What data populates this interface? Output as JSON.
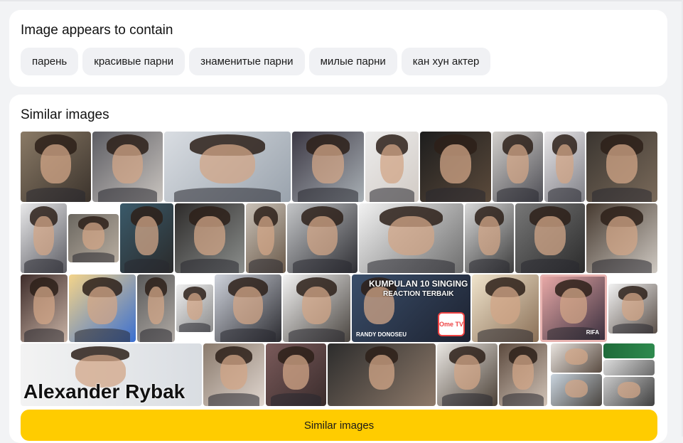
{
  "tags_section": {
    "title": "Image appears to contain",
    "chips": [
      {
        "label": "парень"
      },
      {
        "label": "красивые парни"
      },
      {
        "label": "знаменитые парни"
      },
      {
        "label": "милые парни"
      },
      {
        "label": "кан хун актер"
      }
    ]
  },
  "similar_section": {
    "title": "Similar images",
    "button_label": "Similar images",
    "overlays": {
      "alexander": "Alexander Rybak",
      "kumpulan": "KUMPULAN 10 SINGING",
      "reaction": "REACTION TERBAIK",
      "randy": "RANDY DONOSEU",
      "ome_logo": "Ome TV",
      "rifa": "RIFA"
    }
  },
  "colors": {
    "button": "#ffcc00",
    "chip": "#f0f1f4",
    "card": "#ffffff",
    "page": "#f2f3f5"
  }
}
